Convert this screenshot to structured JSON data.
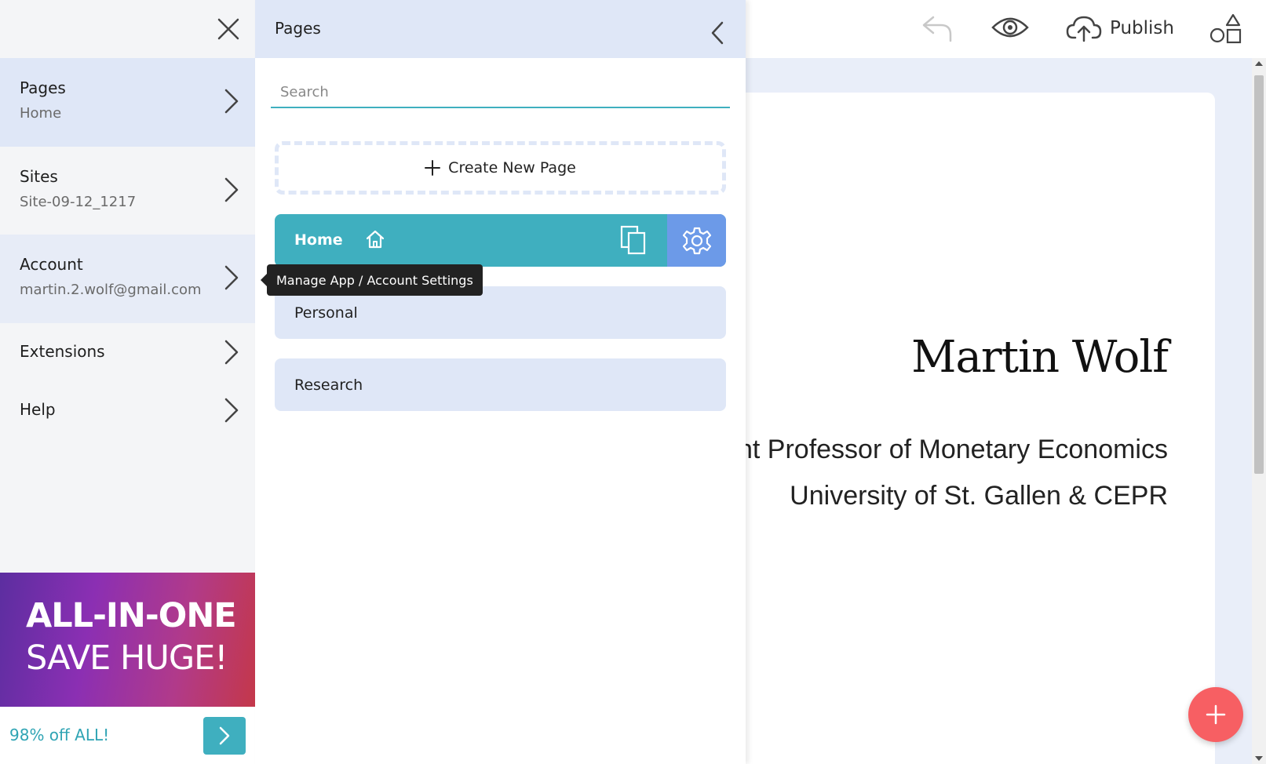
{
  "toolbar": {
    "publish_label": "Publish",
    "icons": [
      "undo-icon",
      "eye-icon",
      "cloud-upload-icon",
      "shapes-icon"
    ]
  },
  "left_menu": {
    "items": [
      {
        "title": "Pages",
        "subtitle": "Home"
      },
      {
        "title": "Sites",
        "subtitle": "Site-09-12_1217"
      },
      {
        "title": "Account",
        "subtitle": "martin.2.wolf@gmail.com"
      },
      {
        "title": "Extensions"
      },
      {
        "title": "Help"
      }
    ],
    "promo": {
      "line1": "ALL-IN-ONE",
      "line2": "SAVE HUGE!",
      "footer_text": "98% off ALL!"
    }
  },
  "pages_panel": {
    "title": "Pages",
    "search_placeholder": "Search",
    "create_label": "Create New Page",
    "pages": [
      "Home",
      "Personal",
      "Research"
    ]
  },
  "tooltip": {
    "text": "Manage App / Account Settings"
  },
  "site_preview": {
    "name": "Martin Wolf",
    "line1": "nt Professor of Monetary Economics",
    "line2": "University of St. Gallen & CEPR"
  },
  "colors": {
    "accent_teal": "#3fafbf",
    "settings_blue": "#6c9ae8",
    "panel_blue": "#dfe7f7",
    "fab_red": "#f75f63"
  }
}
